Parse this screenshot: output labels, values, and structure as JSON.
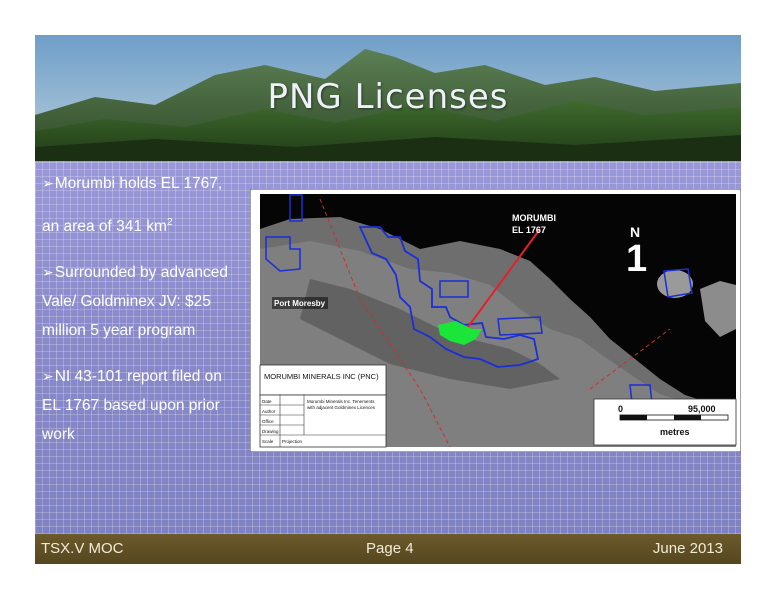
{
  "slide": {
    "title": "PNG Licenses"
  },
  "bullets": [
    {
      "line1": "Morumbi holds EL 1767,",
      "line2": "an area of 341 km",
      "sup": "2"
    },
    {
      "line1": "Surrounded by advanced",
      "line2": "Vale/ Goldminex JV: $25",
      "line3": "million 5 year program"
    },
    {
      "line1": "NI 43-101 report filed on",
      "line2": "EL 1767 based upon prior",
      "line3": "work"
    }
  ],
  "bullet_icon": "arrow-bullet-icon",
  "map": {
    "callout": "MORUMBI",
    "callout2": "EL 1767",
    "north_letter": "N",
    "north_number": "1",
    "place": "Port Moresby",
    "company": "MORUMBI MINERALS INC (PNC)",
    "scale_start": "0",
    "scale_end": "95,000",
    "scale_unit": "metres",
    "legend_text1": "Morumbi Minerals Inc. Tenements",
    "legend_text2": "with adjacent Goldminex Licences",
    "legend_labels": [
      "Date",
      "Author",
      "Office",
      "Drawing",
      "Scale"
    ],
    "projection": "Projection",
    "colors": {
      "tenement": "#1a2fd6",
      "highlight": "#19e639",
      "pointer": "#e5202a"
    }
  },
  "footer": {
    "left": "TSX.V MOC",
    "center": "Page 4",
    "right": "June 2013"
  }
}
